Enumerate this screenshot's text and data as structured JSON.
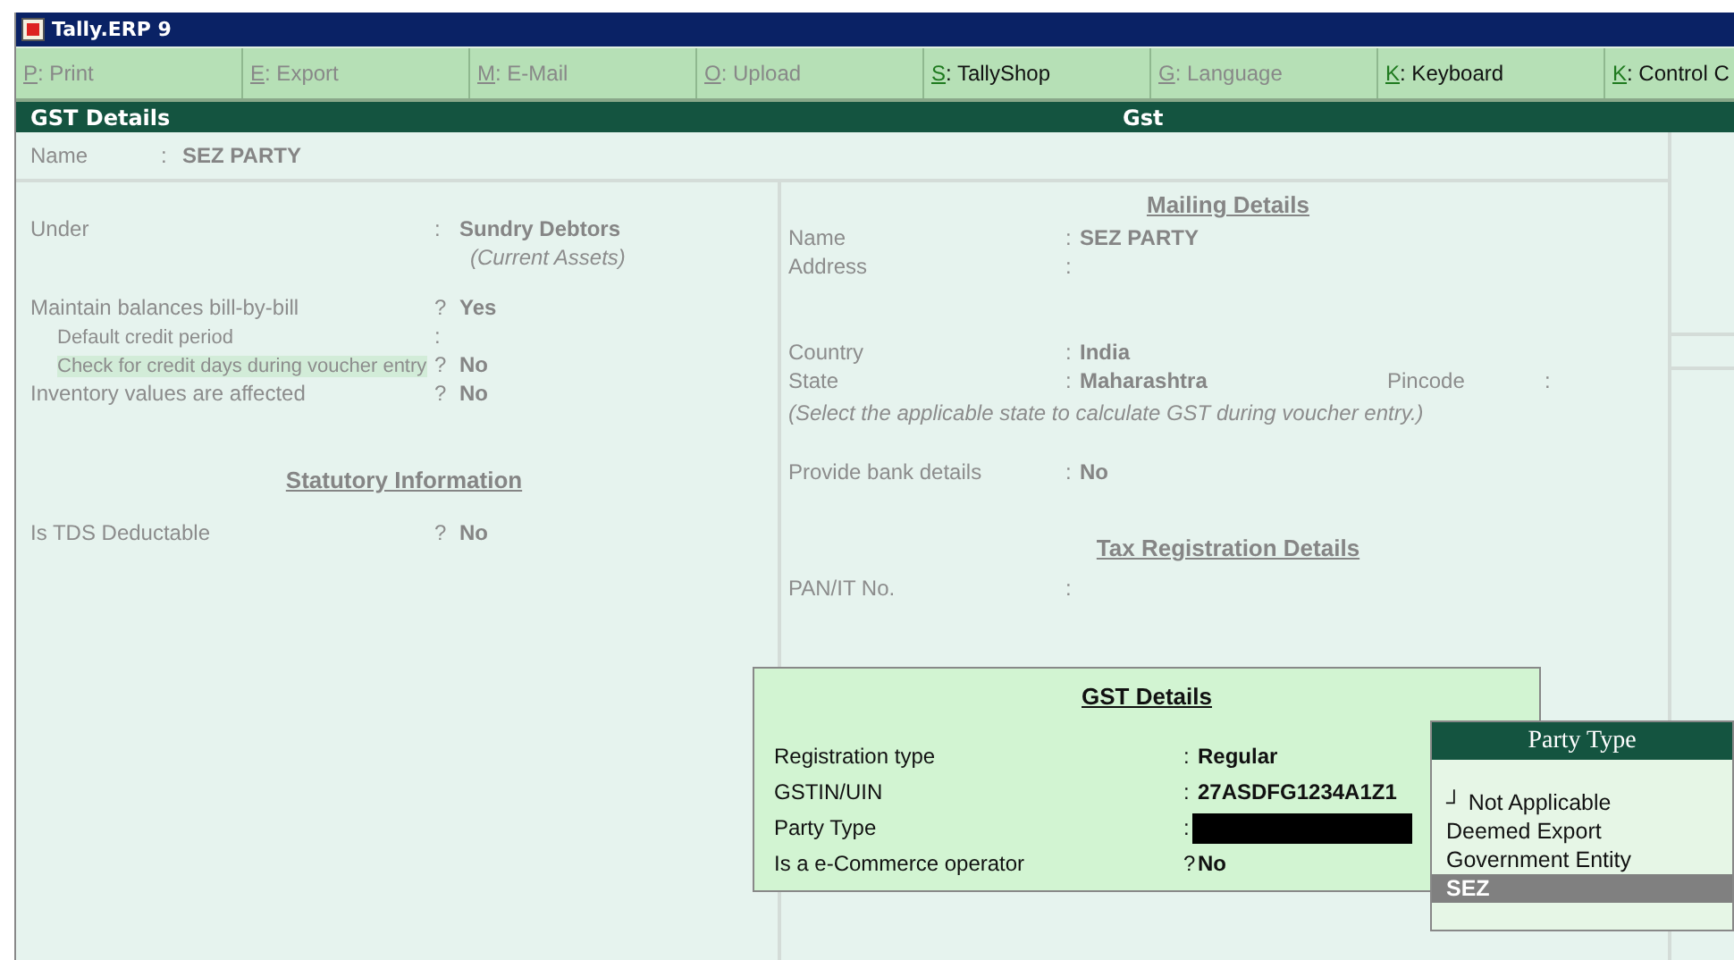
{
  "window": {
    "title": "Tally.ERP 9"
  },
  "buttons": [
    {
      "key": "P",
      "sep": ":",
      "label": "Print",
      "disabled": true
    },
    {
      "key": "E",
      "sep": ":",
      "label": "Export",
      "disabled": true
    },
    {
      "key": "M",
      "sep": ":",
      "label": "E-Mail",
      "disabled": true
    },
    {
      "key": "O",
      "sep": ":",
      "label": "Upload",
      "disabled": true
    },
    {
      "key": "S",
      "sep": ":",
      "label": "TallyShop",
      "disabled": false
    },
    {
      "key": "G",
      "sep": ":",
      "label": "Language",
      "disabled": true
    },
    {
      "key": "K",
      "sep": ":",
      "label": "Keyboard",
      "disabled": false
    },
    {
      "key": "K",
      "sep": ":",
      "label": "Control C",
      "disabled": false
    }
  ],
  "header": {
    "left": "GST Details",
    "center": "Gst"
  },
  "name_row": {
    "label": "Name",
    "sep": ":",
    "value": "SEZ PARTY"
  },
  "left_panel": {
    "under": {
      "label": "Under",
      "sep": ":",
      "value": "Sundry Debtors",
      "note": "(Current Assets)"
    },
    "rows": [
      {
        "label": "Maintain balances bill-by-bill",
        "sep": "?",
        "value": "Yes",
        "highlighted": false,
        "children": [
          {
            "label": "Default credit period",
            "sep": ":",
            "highlighted": false
          },
          {
            "label": "Check for credit days during voucher entry",
            "sep": "?",
            "value": "No",
            "highlighted": true
          }
        ]
      },
      {
        "label": "Inventory values are affected",
        "sep": "?",
        "value": "No",
        "highlighted": false
      }
    ],
    "statutory_heading": "Statutory Information",
    "statutory_rows": [
      {
        "label": "Is TDS Deductable",
        "sep": "?",
        "value": "No"
      }
    ]
  },
  "mailing": {
    "heading": "Mailing Details",
    "rows": [
      {
        "label": "Name",
        "sep": ":",
        "value": "SEZ PARTY"
      },
      {
        "label": "Address",
        "sep": ":"
      }
    ],
    "country": {
      "label": "Country",
      "sep": ":",
      "value": "India"
    },
    "state": {
      "label": "State",
      "sep": ":",
      "value": "Maharashtra"
    },
    "pincode": {
      "label": "Pincode",
      "sep": ":"
    },
    "hint": "(Select the applicable state to calculate GST during voucher entry.)",
    "bank": {
      "label": "Provide bank details",
      "sep": ":",
      "value": "No"
    },
    "tax_heading": "Tax Registration Details",
    "tax_rows": [
      {
        "label": "PAN/IT No.",
        "sep": ":"
      }
    ]
  },
  "gst_popup": {
    "title": "GST Details",
    "rows": [
      {
        "kind": "text",
        "label": "Registration type",
        "sep": ":",
        "value": "Regular"
      },
      {
        "kind": "text",
        "label": "GSTIN/UIN",
        "sep": ":",
        "value": "27ASDFG1234A1Z1"
      },
      {
        "kind": "input",
        "label": "Party Type",
        "sep": ":"
      },
      {
        "kind": "text",
        "label": "Is a e-Commerce operator",
        "sep": "?",
        "value": "No"
      }
    ]
  },
  "party_type_list": {
    "title": "Party Type",
    "items": [
      {
        "label": "┘ Not Applicable",
        "selected": false
      },
      {
        "label": "Deemed Export",
        "selected": false
      },
      {
        "label": "Government Entity",
        "selected": false
      },
      {
        "label": "SEZ",
        "selected": true
      }
    ]
  }
}
